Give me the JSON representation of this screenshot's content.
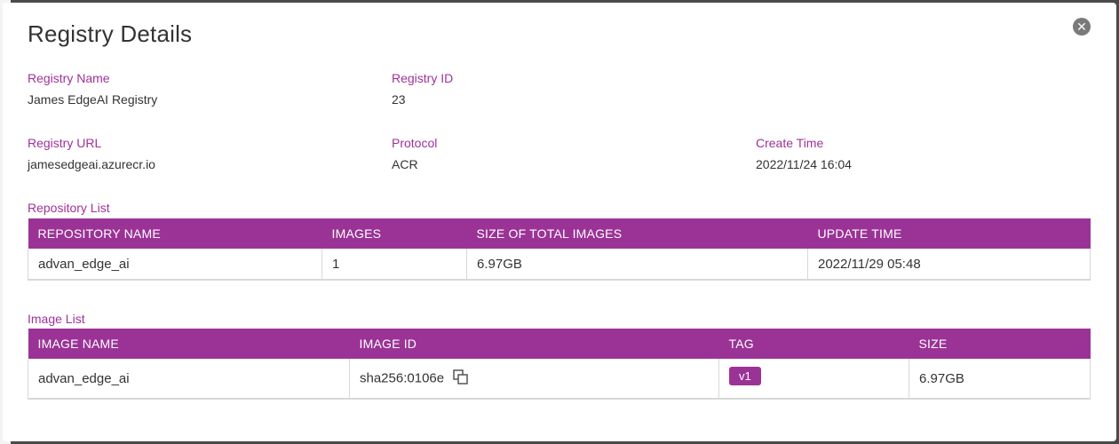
{
  "modal": {
    "title": "Registry Details",
    "close_icon": "close-icon"
  },
  "fields": {
    "registry_name": {
      "label": "Registry Name",
      "value": "James EdgeAI Registry"
    },
    "registry_id": {
      "label": "Registry ID",
      "value": "23"
    },
    "registry_url": {
      "label": "Registry URL",
      "value": "jamesedgeai.azurecr.io"
    },
    "protocol": {
      "label": "Protocol",
      "value": "ACR"
    },
    "create_time": {
      "label": "Create Time",
      "value": "2022/11/24 16:04"
    }
  },
  "repository_list": {
    "label": "Repository List",
    "headers": [
      "REPOSITORY NAME",
      "IMAGES",
      "SIZE OF TOTAL IMAGES",
      "UPDATE TIME"
    ],
    "rows": [
      [
        "advan_edge_ai",
        "1",
        "6.97GB",
        "2022/11/29 05:48"
      ]
    ]
  },
  "image_list": {
    "label": "Image List",
    "headers": [
      "IMAGE NAME",
      "IMAGE ID",
      "TAG",
      "SIZE"
    ],
    "rows": [
      {
        "name": "advan_edge_ai",
        "id": "sha256:0106e",
        "tag": "v1",
        "size": "6.97GB"
      }
    ],
    "copy_icon": "copy-icon"
  },
  "colors": {
    "accent": "#9b3396",
    "label": "#a0319a",
    "text": "#333333"
  }
}
